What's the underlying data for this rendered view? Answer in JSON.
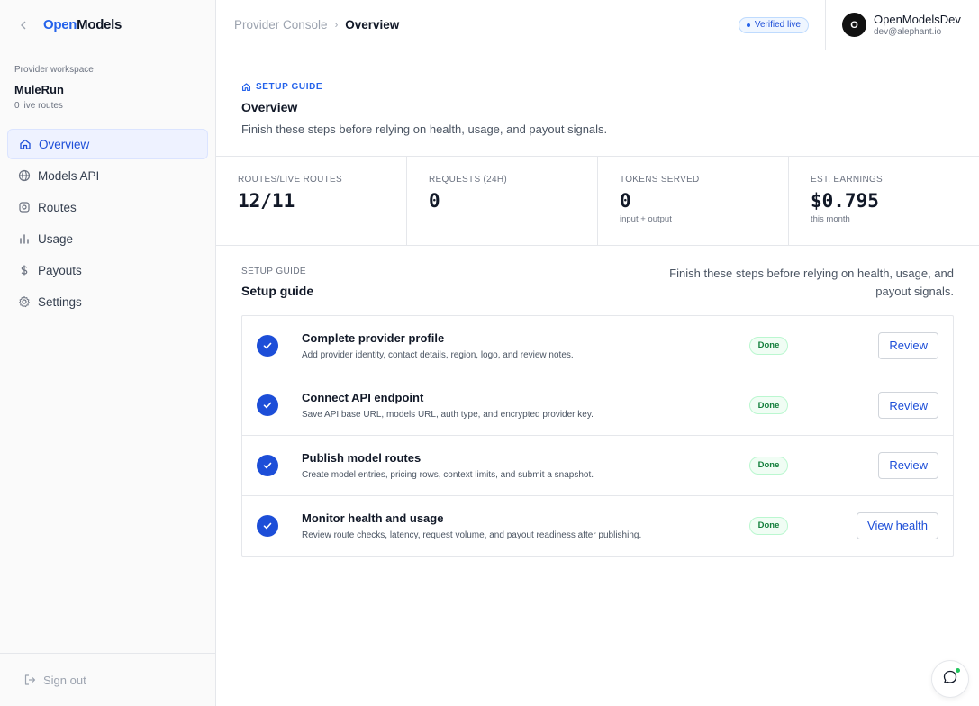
{
  "brand": {
    "part1": "Open",
    "part2": "Models"
  },
  "workspace": {
    "label": "Provider workspace",
    "name": "MuleRun",
    "routes": "0 live routes"
  },
  "nav": {
    "items": [
      {
        "label": "Overview",
        "icon": "home-icon",
        "active": true
      },
      {
        "label": "Models API",
        "icon": "globe-icon"
      },
      {
        "label": "Routes",
        "icon": "route-icon"
      },
      {
        "label": "Usage",
        "icon": "bar-chart-icon"
      },
      {
        "label": "Payouts",
        "icon": "dollar-icon"
      },
      {
        "label": "Settings",
        "icon": "gear-icon"
      }
    ],
    "signout": "Sign out"
  },
  "header": {
    "crumb_root": "Provider Console",
    "crumb_current": "Overview",
    "status": "Verified live",
    "user": {
      "initial": "O",
      "name": "OpenModelsDev",
      "email": "dev@alephant.io"
    }
  },
  "hero": {
    "eyebrow": "SETUP GUIDE",
    "title": "Overview",
    "description": "Finish these steps before relying on health, usage, and payout signals."
  },
  "stats": [
    {
      "label": "ROUTES/LIVE ROUTES",
      "value": "12/11",
      "sub": ""
    },
    {
      "label": "REQUESTS (24H)",
      "value": "0",
      "sub": ""
    },
    {
      "label": "TOKENS SERVED",
      "value": "0",
      "sub": "input + output"
    },
    {
      "label": "EST. EARNINGS",
      "value": "$0.795",
      "sub": "this month"
    }
  ],
  "guide": {
    "label": "SETUP GUIDE",
    "title": "Setup guide",
    "description": "Finish these steps before relying on health, usage, and payout signals.",
    "steps": [
      {
        "title": "Complete provider profile",
        "desc": "Add provider identity, contact details, region, logo, and review notes.",
        "status": "Done",
        "action": "Review"
      },
      {
        "title": "Connect API endpoint",
        "desc": "Save API base URL, models URL, auth type, and encrypted provider key.",
        "status": "Done",
        "action": "Review"
      },
      {
        "title": "Publish model routes",
        "desc": "Create model entries, pricing rows, context limits, and submit a snapshot.",
        "status": "Done",
        "action": "Review"
      },
      {
        "title": "Monitor health and usage",
        "desc": "Review route checks, latency, request volume, and payout readiness after publishing.",
        "status": "Done",
        "action": "View health"
      }
    ]
  },
  "colors": {
    "accent": "#2563eb",
    "success": "#15803d"
  }
}
